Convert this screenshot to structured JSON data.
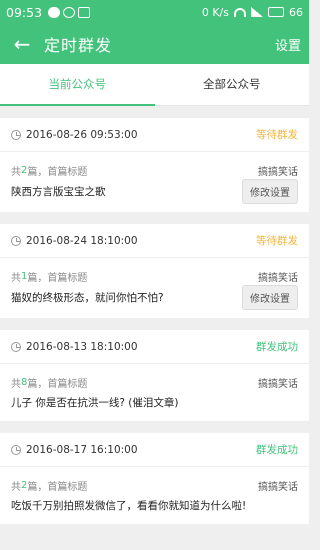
{
  "statusbar": {
    "time": "09:53",
    "net_speed": "0 K/s",
    "battery": "66"
  },
  "appbar": {
    "back_icon": "←",
    "title": "定时群发",
    "settings_label": "设置"
  },
  "tabs": [
    {
      "label": "当前公众号",
      "active": true
    },
    {
      "label": "全部公众号",
      "active": false
    }
  ],
  "colors": {
    "accent": "#43c27c",
    "waiting": "#f2b53a"
  },
  "items": [
    {
      "datetime": "2016-08-26 09:53:00",
      "status": "等待群发",
      "count_pre": "共",
      "count": "2",
      "count_post": "篇，首篇标题",
      "category": "搞搞笑话",
      "headline": "陕西方言版宝宝之歌",
      "edit_label": "修改设置"
    },
    {
      "datetime": "2016-08-24 18:10:00",
      "status": "等待群发",
      "count_pre": "共",
      "count": "1",
      "count_post": "篇，首篇标题",
      "category": "搞搞笑话",
      "headline": "猫奴的终极形态，就问你怕不怕?",
      "edit_label": "修改设置"
    },
    {
      "datetime": "2016-08-13 18:10:00",
      "status": "群发成功",
      "count_pre": "共",
      "count": "8",
      "count_post": "篇，首篇标题",
      "category": "搞搞笑话",
      "headline": "儿子  你是否在抗洪一线?  (催泪文章)"
    },
    {
      "datetime": "2016-08-17 16:10:00",
      "status": "群发成功",
      "count_pre": "共",
      "count": "2",
      "count_post": "篇，首篇标题",
      "category": "搞搞笑话",
      "headline": "吃饭千万别拍照发微信了，看看你就知道为什么啦!"
    }
  ]
}
